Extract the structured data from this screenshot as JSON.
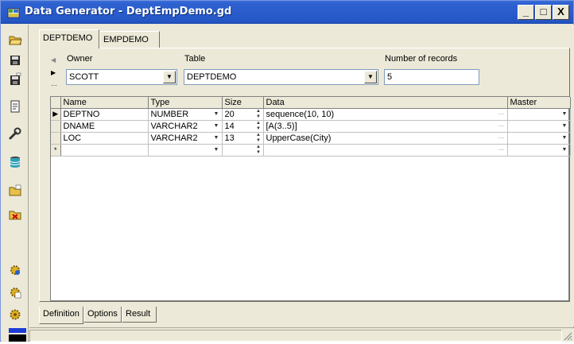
{
  "window": {
    "title": "Data Generator - DeptEmpDemo.gd",
    "min_label": "_",
    "max_label": "□",
    "close_label": "X"
  },
  "toolbar": {
    "items": [
      "open-folder-icon",
      "save-icon",
      "save-as-icon",
      "document-icon",
      "wrench-icon",
      "database-icon",
      "folder-open-icon",
      "folder-delete-icon",
      "gear-blue-icon",
      "gear-yellow-icon",
      "gear-icon"
    ]
  },
  "top_tabs": [
    "DEPTDEMO",
    "EMPDEMO"
  ],
  "form": {
    "owner_label": "Owner",
    "owner_value": "SCOTT",
    "table_label": "Table",
    "table_value": "DEPTDEMO",
    "records_label": "Number of records",
    "records_value": "5"
  },
  "grid": {
    "columns": [
      "Name",
      "Type",
      "Size",
      "Data",
      "Master"
    ],
    "rows": [
      {
        "name": "DEPTNO",
        "type": "NUMBER",
        "size": "20",
        "data": "sequence(10, 10)",
        "master": ""
      },
      {
        "name": "DNAME",
        "type": "VARCHAR2",
        "size": "14",
        "data": "[A(3..5)]",
        "master": ""
      },
      {
        "name": "LOC",
        "type": "VARCHAR2",
        "size": "13",
        "data": "UpperCase(City)",
        "master": ""
      },
      {
        "name": "",
        "type": "",
        "size": "",
        "data": "",
        "master": ""
      }
    ],
    "current_marker": "▶",
    "new_marker": "*"
  },
  "bottom_tabs": [
    "Definition",
    "Options",
    "Result"
  ],
  "colors": {
    "title_bar": "#2a5ccc",
    "frame": "#ece9d8"
  }
}
